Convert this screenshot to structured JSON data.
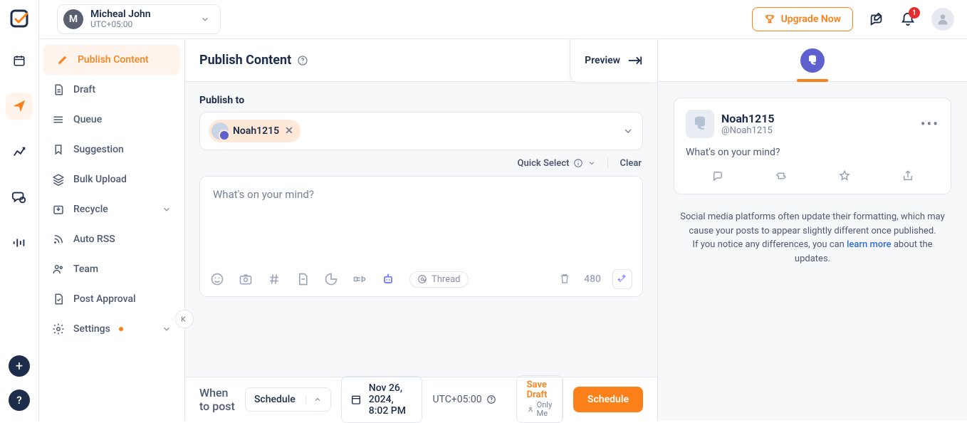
{
  "topbar": {
    "account_initial": "M",
    "account_name": "Micheal John",
    "account_tz": "UTC+05:00",
    "upgrade": "Upgrade Now",
    "notif_count": "1"
  },
  "rail_icons": [
    "logo",
    "calendar",
    "send",
    "analytics",
    "chat",
    "audio"
  ],
  "sidenav": {
    "items": [
      {
        "icon": "pencil",
        "label": "Publish Content",
        "active": true
      },
      {
        "icon": "doc",
        "label": "Draft"
      },
      {
        "icon": "queue",
        "label": "Queue"
      },
      {
        "icon": "bookmark",
        "label": "Suggestion"
      },
      {
        "icon": "stack",
        "label": "Bulk Upload"
      },
      {
        "icon": "recycle",
        "label": "Recycle",
        "chev": true
      },
      {
        "icon": "rss",
        "label": "Auto RSS"
      },
      {
        "icon": "team",
        "label": "Team"
      },
      {
        "icon": "approve",
        "label": "Post Approval"
      },
      {
        "icon": "settings",
        "label": "Settings",
        "chev": true,
        "dot": true
      }
    ]
  },
  "editor": {
    "title": "Publish Content",
    "preview_tab": "Preview",
    "publish_to_label": "Publish to",
    "chip_name": "Noah1215",
    "quick_select": "Quick Select",
    "clear": "Clear",
    "placeholder": "What's on your mind?",
    "thread_label": "Thread",
    "char_count": "480"
  },
  "bottom": {
    "when": "When to post",
    "schedule_mode": "Schedule",
    "datetime": "Nov 26, 2024, 8:02 PM",
    "tz": "UTC+05:00",
    "save_draft": "Save Draft",
    "only_me": "Only Me",
    "schedule_btn": "Schedule"
  },
  "preview": {
    "card": {
      "name": "Noah1215",
      "handle": "@Noah1215",
      "body": "What's on your mind?"
    },
    "note_l1": "Social media platforms often update their formatting, which may cause your posts to appear slightly different once published.",
    "note_l2a": "If you notice any differences, you can ",
    "note_link": "learn more",
    "note_l2b": " about the updates."
  }
}
